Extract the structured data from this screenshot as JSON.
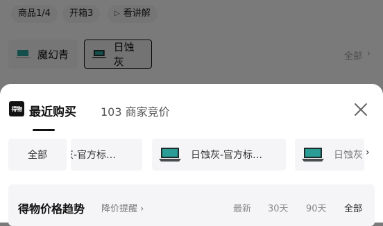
{
  "top_chips": {
    "product": "商品1/4",
    "unbox": "开箱3",
    "explain": "看讲解"
  },
  "colors": [
    {
      "name": "魔幻青"
    },
    {
      "name": "日蚀灰",
      "selected": true
    }
  ],
  "all_colors_label": "全部",
  "sheet": {
    "logo_text": "得物",
    "tab_recent": "最近购买",
    "tab_bids": "103 商家竞价",
    "filters": [
      {
        "label": "全部"
      },
      {
        "label": "灰-官方标…"
      },
      {
        "label": "日蚀灰-官方标…"
      },
      {
        "label": "日蚀灰"
      }
    ],
    "trend": {
      "title": "得物价格趋势",
      "remind": "降价提醒 ›",
      "options": [
        "最新",
        "30天",
        "90天",
        "全部"
      ]
    }
  },
  "theme": {
    "accent": "#111111",
    "overlay": "rgba(0,0,0,0.5)",
    "laptop_screen": "#1f8a86"
  }
}
